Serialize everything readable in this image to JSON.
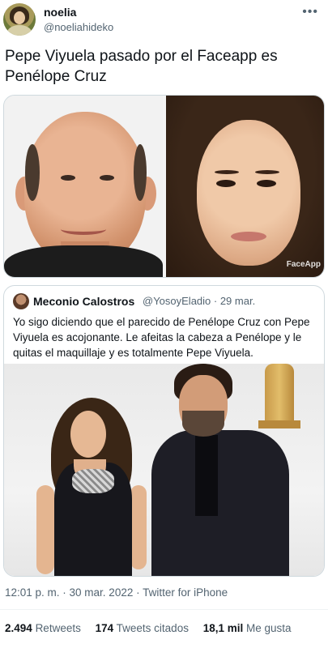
{
  "author": {
    "display_name": "noelia",
    "handle": "@noeliahideko"
  },
  "more_icon": "more-horizontal-icon",
  "tweet_text": "Pepe Viyuela pasado por el Faceapp es Penélope Cruz",
  "media": {
    "watermark": "FaceApp"
  },
  "quoted_tweet": {
    "display_name": "Meconio Calostros",
    "meta": "@YosoyEladio · 29 mar.",
    "text": "Yo sigo diciendo que el parecido de Penélope Cruz con Pepe Viyuela es acojonante. Le afeitas la cabeza a Penélope y le quitas el maquillaje y es totalmente Pepe Viyuela."
  },
  "timestamp": "12:01 p. m. · 30 mar. 2022 · Twitter for iPhone",
  "stats": {
    "retweets_count": "2.494",
    "retweets_label": "Retweets",
    "quotes_count": "174",
    "quotes_label": "Tweets citados",
    "likes_count": "18,1 mil",
    "likes_label": "Me gusta"
  },
  "colors": {
    "text": "#0f1419",
    "secondary": "#536471",
    "border": "#cfd9de"
  }
}
